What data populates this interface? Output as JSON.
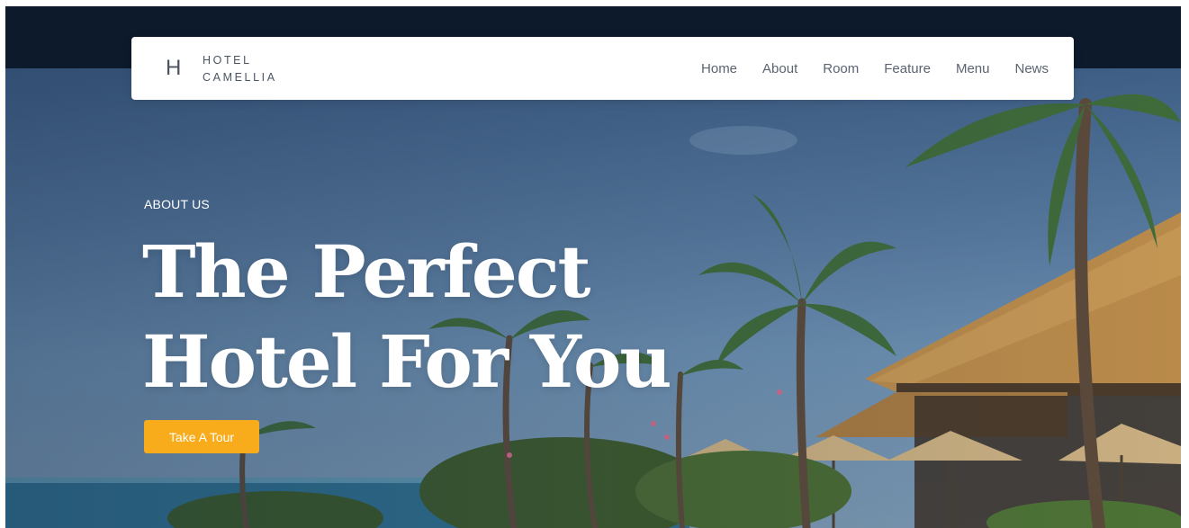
{
  "brand": {
    "mark": "H",
    "line1": "HOTEL",
    "line2": "CAMELLIA"
  },
  "nav": {
    "items": [
      "Home",
      "About",
      "Room",
      "Feature",
      "Menu",
      "News"
    ]
  },
  "hero": {
    "eyebrow": "ABOUT US",
    "headline_line1": "The Perfect",
    "headline_line2": "Hotel For You",
    "cta_label": "Take A Tour"
  },
  "colors": {
    "accent": "#f8ab1b",
    "header_dark": "#0c1a2c",
    "nav_text": "#5b6472"
  }
}
